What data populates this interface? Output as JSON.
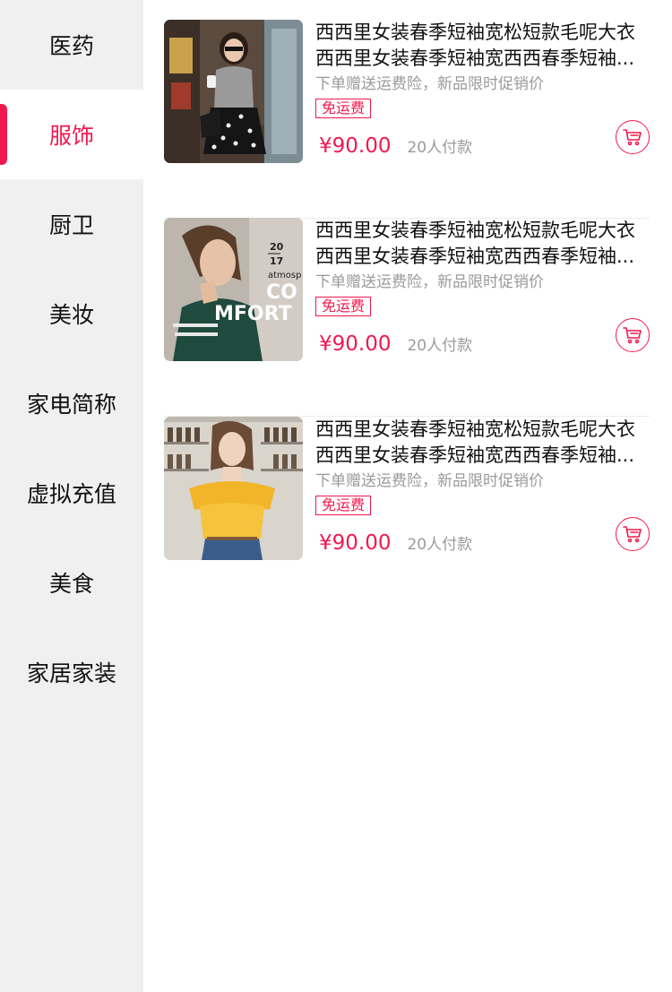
{
  "theme": {
    "accent": "#f0194f",
    "sidebar_bg": "#f0f0f0",
    "muted_text": "#9a9a9a"
  },
  "categories": [
    {
      "label": "医药",
      "active": false
    },
    {
      "label": "服饰",
      "active": true
    },
    {
      "label": "厨卫",
      "active": false
    },
    {
      "label": "美妆",
      "active": false
    },
    {
      "label": "家电简称",
      "active": false
    },
    {
      "label": "虚拟充值",
      "active": false
    },
    {
      "label": "美食",
      "active": false
    },
    {
      "label": "家居家装",
      "active": false
    }
  ],
  "products": [
    {
      "image": "woman-gray-top-polka-skirt",
      "title_line1": "西西里女装春季短袖宽松短款毛呢大衣",
      "title_line2": "西西里女装春季短袖宽西西春季短袖...",
      "promo": "下单赠送运费险，新品限时促销价",
      "badge": "免运费",
      "price": "¥90.00",
      "sold": "20人付款",
      "cart_icon": "cart-icon"
    },
    {
      "image": "woman-green-sweater-magazine",
      "image_text": {
        "year_top": "20",
        "year_bottom": "17",
        "word": "atmosp",
        "big1": "CO",
        "big2": "MFORT"
      },
      "title_line1": "西西里女装春季短袖宽松短款毛呢大衣",
      "title_line2": "西西里女装春季短袖宽西西春季短袖...",
      "promo": "下单赠送运费险，新品限时促销价",
      "badge": "免运费",
      "price": "¥90.00",
      "sold": "20人付款",
      "cart_icon": "cart-icon"
    },
    {
      "image": "woman-yellow-ruffle-blouse",
      "title_line1": "西西里女装春季短袖宽松短款毛呢大衣",
      "title_line2": "西西里女装春季短袖宽西西春季短袖...",
      "promo": "下单赠送运费险，新品限时促销价",
      "badge": "免运费",
      "price": "¥90.00",
      "sold": "20人付款",
      "cart_icon": "cart-icon"
    }
  ]
}
